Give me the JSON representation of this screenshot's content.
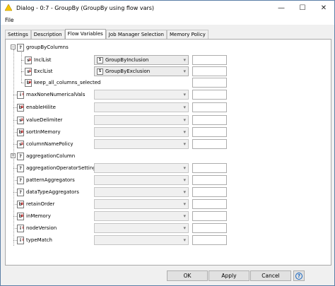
{
  "window": {
    "title": "Dialog - 0:7 - GroupBy (GroupBy using flow vars)",
    "minimize": "—",
    "maximize": "☐",
    "close": "✕"
  },
  "menu": {
    "file": "File"
  },
  "tabs": [
    {
      "label": "Settings"
    },
    {
      "label": "Description"
    },
    {
      "label": "Flow Variables"
    },
    {
      "label": "Job Manager Selection"
    },
    {
      "label": "Memory Policy"
    }
  ],
  "tree": {
    "groupByColumns": {
      "label": "groupByColumns",
      "toggle": "−",
      "icon": "?",
      "children": [
        {
          "label": "InclList",
          "icon": "s",
          "value": "GroupByInclusion",
          "field": ""
        },
        {
          "label": "ExclList",
          "icon": "s",
          "value": "GroupByExclusion",
          "field": ""
        },
        {
          "label": "keep_all_columns_selected",
          "icon": "b",
          "field": ""
        }
      ]
    },
    "settings": [
      {
        "label": "maxNoneNumericalVals",
        "icon": "i"
      },
      {
        "label": "enableHilite",
        "icon": "b"
      },
      {
        "label": "valueDelimiter",
        "icon": "s"
      },
      {
        "label": "sortInMemory",
        "icon": "b"
      },
      {
        "label": "columnNamePolicy",
        "icon": "s"
      }
    ],
    "aggregationColumn": {
      "label": "aggregationColumn",
      "toggle": "+",
      "icon": "?"
    },
    "settings2": [
      {
        "label": "aggregationOperatorSettings",
        "icon": "?"
      },
      {
        "label": "patternAggregators",
        "icon": "?"
      },
      {
        "label": "dataTypeAggregators",
        "icon": "?"
      },
      {
        "label": "retainOrder",
        "icon": "b"
      },
      {
        "label": "inMemory",
        "icon": "b"
      },
      {
        "label": "nodeVersion",
        "icon": "i"
      },
      {
        "label": "typeMatch",
        "icon": "i"
      }
    ]
  },
  "buttons": {
    "ok": "OK",
    "apply": "Apply",
    "cancel": "Cancel",
    "help": "?"
  },
  "colors": {
    "accent_border": "#5b7fa6",
    "help_blue": "#1565c0",
    "title_icon": "#f5c400"
  }
}
